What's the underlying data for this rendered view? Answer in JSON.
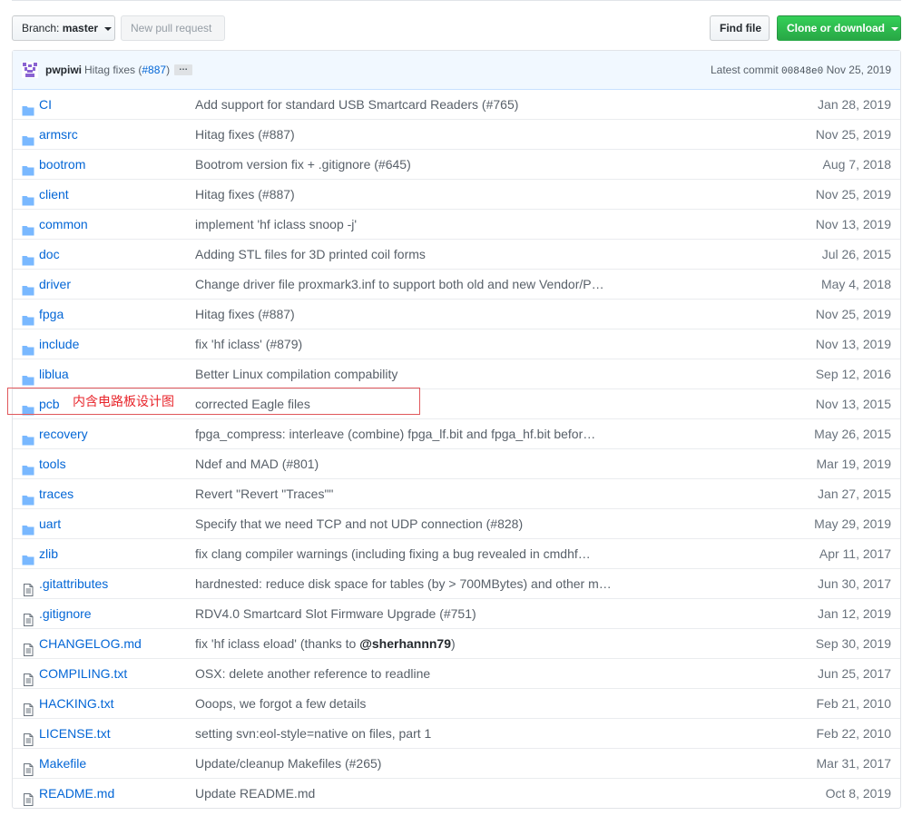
{
  "toolbar": {
    "branch_label": "Branch:",
    "branch_value": "master",
    "new_pull_request": "New pull request",
    "find_file": "Find file",
    "clone_or_download": "Clone or download"
  },
  "commit": {
    "author": "pwpiwi",
    "message": "Hitag fixes (",
    "pr": "#887",
    "message_end": ")",
    "ellipsis": "…",
    "latest_label": "Latest commit",
    "sha": "00848e0",
    "date": "Nov 25, 2019"
  },
  "annotation": {
    "text": "内含电路板设计图",
    "color": "#e8262c"
  },
  "files": [
    {
      "icon": "folder-icon",
      "name": "CI",
      "message": "Add support for standard USB Smartcard Readers (#765)",
      "age": "Jan 28, 2019"
    },
    {
      "icon": "folder-icon",
      "name": "armsrc",
      "message": "Hitag fixes (#887)",
      "age": "Nov 25, 2019"
    },
    {
      "icon": "folder-icon",
      "name": "bootrom",
      "message": "Bootrom version fix + .gitignore (#645)",
      "age": "Aug 7, 2018"
    },
    {
      "icon": "folder-icon",
      "name": "client",
      "message": "Hitag fixes (#887)",
      "age": "Nov 25, 2019"
    },
    {
      "icon": "folder-icon",
      "name": "common",
      "message": "implement 'hf iclass snoop -j'",
      "age": "Nov 13, 2019"
    },
    {
      "icon": "folder-icon",
      "name": "doc",
      "message": "Adding STL files for 3D printed coil forms",
      "age": "Jul 26, 2015"
    },
    {
      "icon": "folder-icon",
      "name": "driver",
      "message": "Change driver file proxmark3.inf to support both old and new Vendor/P…",
      "age": "May 4, 2018"
    },
    {
      "icon": "folder-icon",
      "name": "fpga",
      "message": "Hitag fixes (#887)",
      "age": "Nov 25, 2019"
    },
    {
      "icon": "folder-icon",
      "name": "include",
      "message": "fix 'hf iclass' (#879)",
      "age": "Nov 13, 2019"
    },
    {
      "icon": "folder-icon",
      "name": "liblua",
      "message": "Better Linux compilation compability",
      "age": "Sep 12, 2016"
    },
    {
      "icon": "folder-icon",
      "name": "pcb",
      "message": "corrected Eagle files",
      "age": "Nov 13, 2015"
    },
    {
      "icon": "folder-icon",
      "name": "recovery",
      "message": "fpga_compress: interleave (combine) fpga_lf.bit and fpga_hf.bit befor…",
      "age": "May 26, 2015"
    },
    {
      "icon": "folder-icon",
      "name": "tools",
      "message": "Ndef and MAD (#801)",
      "age": "Mar 19, 2019"
    },
    {
      "icon": "folder-icon",
      "name": "traces",
      "message": "Revert \"Revert \"Traces\"\"",
      "age": "Jan 27, 2015"
    },
    {
      "icon": "folder-icon",
      "name": "uart",
      "message": "Specify that we need TCP and not UDP connection (#828)",
      "age": "May 29, 2019"
    },
    {
      "icon": "folder-icon",
      "name": "zlib",
      "message": "fix clang compiler warnings (including fixing a bug revealed in cmdhf…",
      "age": "Apr 11, 2017"
    },
    {
      "icon": "file-icon",
      "name": ".gitattributes",
      "message": "hardnested: reduce disk space for tables (by > 700MBytes) and other m…",
      "age": "Jun 30, 2017"
    },
    {
      "icon": "file-icon",
      "name": ".gitignore",
      "message": "RDV4.0 Smartcard Slot Firmware Upgrade (#751)",
      "age": "Jan 12, 2019"
    },
    {
      "icon": "file-icon",
      "name": "CHANGELOG.md",
      "message": "fix 'hf iclass eload' (thanks to ",
      "message_bold": "@sherhannn79",
      "message_end": ")",
      "age": "Sep 30, 2019"
    },
    {
      "icon": "file-icon",
      "name": "COMPILING.txt",
      "message": "OSX: delete another reference to readline",
      "age": "Jun 25, 2017"
    },
    {
      "icon": "file-icon",
      "name": "HACKING.txt",
      "message": "Ooops, we forgot a few details",
      "age": "Feb 21, 2010"
    },
    {
      "icon": "file-icon",
      "name": "LICENSE.txt",
      "message": "setting svn:eol-style=native on files, part 1",
      "age": "Feb 22, 2010"
    },
    {
      "icon": "file-icon",
      "name": "Makefile",
      "message": "Update/cleanup Makefiles (#265)",
      "age": "Mar 31, 2017"
    },
    {
      "icon": "file-icon",
      "name": "README.md",
      "message": "Update README.md",
      "age": "Oct 8, 2019"
    }
  ]
}
